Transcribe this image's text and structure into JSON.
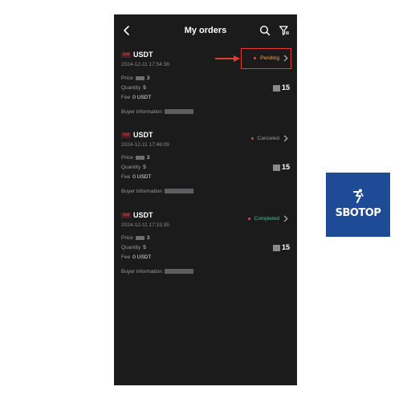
{
  "header": {
    "title": "My orders"
  },
  "orders": [
    {
      "badge": "Sell",
      "coin": "USDT",
      "datetime": "2024-12-11 17:54:38",
      "status": "Pending",
      "status_color": "#f0a640",
      "price_label": "Price",
      "price_value": "3",
      "quantity_label": "Quantity",
      "quantity_value": "5",
      "fee_label": "Fee",
      "fee_value": "0 USDT",
      "buyer_label": "Buyer information",
      "amount": "15"
    },
    {
      "badge": "Sell",
      "coin": "USDT",
      "datetime": "2024-12-11 17:46:09",
      "status": "Canceled",
      "status_color": "#9a9a9e",
      "price_label": "Price",
      "price_value": "3",
      "quantity_label": "Quantity",
      "quantity_value": "5",
      "fee_label": "Fee",
      "fee_value": "0 USDT",
      "buyer_label": "Buyer information",
      "amount": "15"
    },
    {
      "badge": "Sell",
      "coin": "USDT",
      "datetime": "2024-12-11 17:15:35",
      "status": "Completed",
      "status_color": "#3cc48f",
      "price_label": "Price",
      "price_value": "3",
      "quantity_label": "Quantity",
      "quantity_value": "5",
      "fee_label": "Fee",
      "fee_value": "0 USDT",
      "buyer_label": "Buyer information",
      "amount": "15"
    }
  ],
  "logo": {
    "text": "SBOTOP",
    "color": "#1e4a96"
  },
  "colors": {
    "background": "#1b1b1c",
    "sell_red": "#e2474b",
    "annotation_red": "#e53b35"
  }
}
